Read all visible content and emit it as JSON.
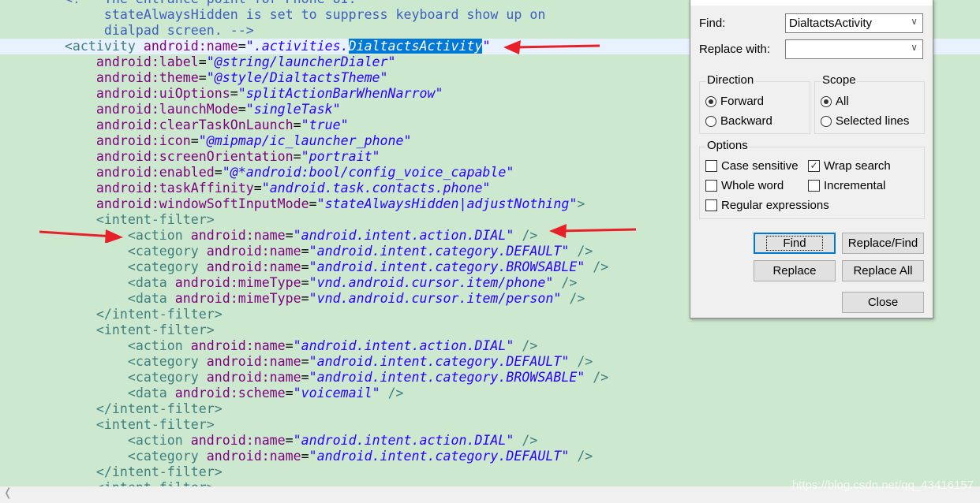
{
  "editor": {
    "lines": [
      [
        {
          "k": "c",
          "s": "        <!-- The entrance point for Phone UI."
        }
      ],
      [
        {
          "k": "c",
          "s": "             stateAlwaysHidden is set to suppress keyboard show up on"
        }
      ],
      [
        {
          "k": "c",
          "s": "             dialpad screen. -->"
        }
      ],
      [
        {
          "k": "t",
          "s": "        <activity "
        },
        {
          "k": "a",
          "s": "android:name"
        },
        {
          "k": "p",
          "s": "="
        },
        {
          "k": "v",
          "s": "\".activities."
        },
        {
          "k": "sel",
          "s": "DialtactsActivity"
        },
        {
          "k": "v",
          "s": "\""
        }
      ],
      [
        {
          "k": "a",
          "s": "            android:label"
        },
        {
          "k": "p",
          "s": "="
        },
        {
          "k": "v",
          "s": "\"@string/launcherDialer\""
        }
      ],
      [
        {
          "k": "a",
          "s": "            android:theme"
        },
        {
          "k": "p",
          "s": "="
        },
        {
          "k": "v",
          "s": "\"@style/DialtactsTheme\""
        }
      ],
      [
        {
          "k": "a",
          "s": "            android:uiOptions"
        },
        {
          "k": "p",
          "s": "="
        },
        {
          "k": "v",
          "s": "\"splitActionBarWhenNarrow\""
        }
      ],
      [
        {
          "k": "a",
          "s": "            android:launchMode"
        },
        {
          "k": "p",
          "s": "="
        },
        {
          "k": "v",
          "s": "\"singleTask\""
        }
      ],
      [
        {
          "k": "a",
          "s": "            android:clearTaskOnLaunch"
        },
        {
          "k": "p",
          "s": "="
        },
        {
          "k": "v",
          "s": "\"true\""
        }
      ],
      [
        {
          "k": "a",
          "s": "            android:icon"
        },
        {
          "k": "p",
          "s": "="
        },
        {
          "k": "v",
          "s": "\"@mipmap/ic_launcher_phone\""
        }
      ],
      [
        {
          "k": "a",
          "s": "            android:screenOrientation"
        },
        {
          "k": "p",
          "s": "="
        },
        {
          "k": "v",
          "s": "\"portrait\""
        }
      ],
      [
        {
          "k": "a",
          "s": "            android:enabled"
        },
        {
          "k": "p",
          "s": "="
        },
        {
          "k": "v",
          "s": "\"@*android:bool/config_voice_capable\""
        }
      ],
      [
        {
          "k": "a",
          "s": "            android:taskAffinity"
        },
        {
          "k": "p",
          "s": "="
        },
        {
          "k": "v",
          "s": "\"android.task.contacts.phone\""
        }
      ],
      [
        {
          "k": "a",
          "s": "            android:windowSoftInputMode"
        },
        {
          "k": "p",
          "s": "="
        },
        {
          "k": "v",
          "s": "\"stateAlwaysHidden|adjustNothing\""
        },
        {
          "k": "t",
          "s": ">"
        }
      ],
      [
        {
          "k": "t",
          "s": "            <intent-filter>"
        }
      ],
      [
        {
          "k": "t",
          "s": "                <action "
        },
        {
          "k": "a",
          "s": "android:name"
        },
        {
          "k": "p",
          "s": "="
        },
        {
          "k": "v",
          "s": "\"android.intent.action.DIAL\""
        },
        {
          "k": "t",
          "s": " />"
        }
      ],
      [
        {
          "k": "t",
          "s": "                <category "
        },
        {
          "k": "a",
          "s": "android:name"
        },
        {
          "k": "p",
          "s": "="
        },
        {
          "k": "v",
          "s": "\"android.intent.category.DEFAULT\""
        },
        {
          "k": "t",
          "s": " />"
        }
      ],
      [
        {
          "k": "t",
          "s": "                <category "
        },
        {
          "k": "a",
          "s": "android:name"
        },
        {
          "k": "p",
          "s": "="
        },
        {
          "k": "v",
          "s": "\"android.intent.category.BROWSABLE\""
        },
        {
          "k": "t",
          "s": " />"
        }
      ],
      [
        {
          "k": "t",
          "s": "                <data "
        },
        {
          "k": "a",
          "s": "android:mimeType"
        },
        {
          "k": "p",
          "s": "="
        },
        {
          "k": "v",
          "s": "\"vnd.android.cursor.item/phone\""
        },
        {
          "k": "t",
          "s": " />"
        }
      ],
      [
        {
          "k": "t",
          "s": "                <data "
        },
        {
          "k": "a",
          "s": "android:mimeType"
        },
        {
          "k": "p",
          "s": "="
        },
        {
          "k": "v",
          "s": "\"vnd.android.cursor.item/person\""
        },
        {
          "k": "t",
          "s": " />"
        }
      ],
      [
        {
          "k": "t",
          "s": "            </intent-filter>"
        }
      ],
      [
        {
          "k": "t",
          "s": "            <intent-filter>"
        }
      ],
      [
        {
          "k": "t",
          "s": "                <action "
        },
        {
          "k": "a",
          "s": "android:name"
        },
        {
          "k": "p",
          "s": "="
        },
        {
          "k": "v",
          "s": "\"android.intent.action.DIAL\""
        },
        {
          "k": "t",
          "s": " />"
        }
      ],
      [
        {
          "k": "t",
          "s": "                <category "
        },
        {
          "k": "a",
          "s": "android:name"
        },
        {
          "k": "p",
          "s": "="
        },
        {
          "k": "v",
          "s": "\"android.intent.category.DEFAULT\""
        },
        {
          "k": "t",
          "s": " />"
        }
      ],
      [
        {
          "k": "t",
          "s": "                <category "
        },
        {
          "k": "a",
          "s": "android:name"
        },
        {
          "k": "p",
          "s": "="
        },
        {
          "k": "v",
          "s": "\"android.intent.category.BROWSABLE\""
        },
        {
          "k": "t",
          "s": " />"
        }
      ],
      [
        {
          "k": "t",
          "s": "                <data "
        },
        {
          "k": "a",
          "s": "android:scheme"
        },
        {
          "k": "p",
          "s": "="
        },
        {
          "k": "v",
          "s": "\"voicemail\""
        },
        {
          "k": "t",
          "s": " />"
        }
      ],
      [
        {
          "k": "t",
          "s": "            </intent-filter>"
        }
      ],
      [
        {
          "k": "t",
          "s": "            <intent-filter>"
        }
      ],
      [
        {
          "k": "t",
          "s": "                <action "
        },
        {
          "k": "a",
          "s": "android:name"
        },
        {
          "k": "p",
          "s": "="
        },
        {
          "k": "v",
          "s": "\"android.intent.action.DIAL\""
        },
        {
          "k": "t",
          "s": " />"
        }
      ],
      [
        {
          "k": "t",
          "s": "                <category "
        },
        {
          "k": "a",
          "s": "android:name"
        },
        {
          "k": "p",
          "s": "="
        },
        {
          "k": "v",
          "s": "\"android.intent.category.DEFAULT\""
        },
        {
          "k": "t",
          "s": " />"
        }
      ],
      [
        {
          "k": "t",
          "s": "            </intent-filter>"
        }
      ],
      [
        {
          "k": "t",
          "s": "            <intent-filter>"
        }
      ]
    ],
    "current_line": 3
  },
  "dialog": {
    "find_label": "Find:",
    "find_value": "DialtactsActivity",
    "replace_label": "Replace with:",
    "replace_value": "",
    "direction_title": "Direction",
    "forward": "Forward",
    "backward": "Backward",
    "direction_selected": "Forward",
    "scope_title": "Scope",
    "all": "All",
    "selected_lines": "Selected lines",
    "scope_selected": "All",
    "options_title": "Options",
    "case_sensitive": "Case sensitive",
    "wrap_search": "Wrap search",
    "whole_word": "Whole word",
    "incremental": "Incremental",
    "regex": "Regular expressions",
    "checked": {
      "case_sensitive": false,
      "wrap_search": true,
      "whole_word": false,
      "incremental": false,
      "regex": false
    },
    "buttons": {
      "find": "Find",
      "replace_find": "Replace/Find",
      "replace": "Replace",
      "replace_all": "Replace All",
      "close": "Close"
    }
  },
  "watermark": "https://blog.csdn.net/qq_43416157",
  "colors": {
    "background": "#cce8cf",
    "annotation_arrow": "#e8202a",
    "selection": "#0078d7"
  }
}
